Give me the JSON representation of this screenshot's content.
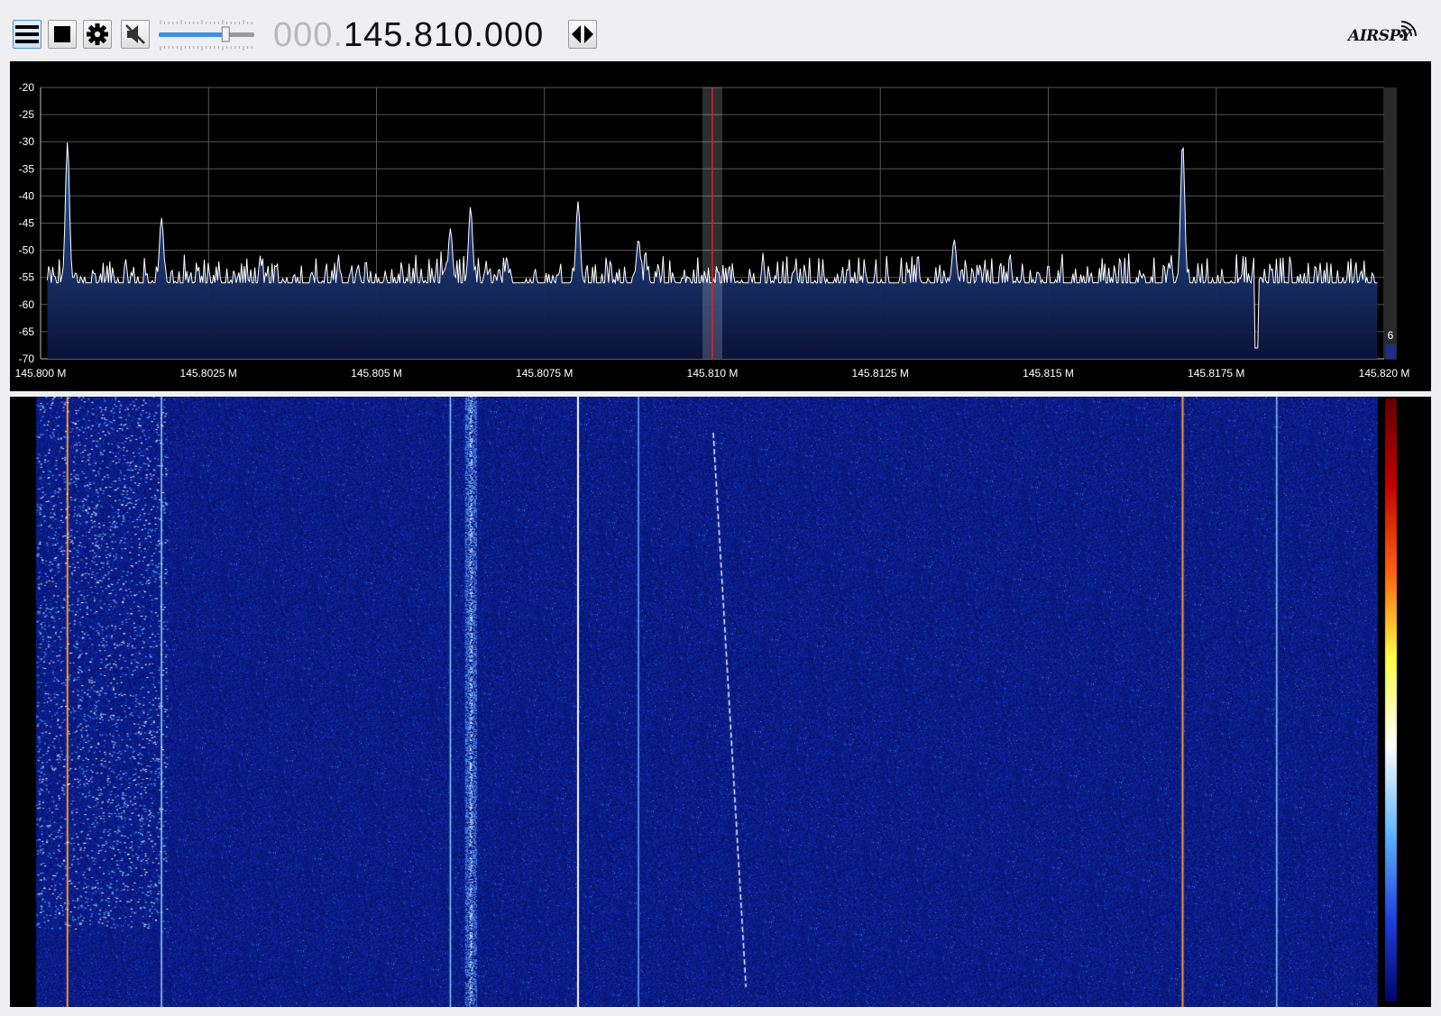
{
  "toolbar": {
    "menu_icon": "hamburger-menu-icon",
    "stop_icon": "stop-square-icon",
    "settings_icon": "gear-icon",
    "mute_icon": "speaker-muted-icon",
    "volume_level": 0.7,
    "frequency_prefix": "000.",
    "frequency_main": "145.810.000",
    "tune_arrows_icon": "left-right-arrows-icon"
  },
  "logo": {
    "text": "AIRSPY",
    "icon": "wireless-signal-icon"
  },
  "spectrum": {
    "y_ticks": [
      "-20",
      "-25",
      "-30",
      "-35",
      "-40",
      "-45",
      "-50",
      "-55",
      "-60",
      "-65",
      "-70"
    ],
    "x_ticks": [
      "145.800 M",
      "145.8025 M",
      "145.805 M",
      "145.8075 M",
      "145.810 M",
      "145.8125 M",
      "145.815 M",
      "145.8175 M",
      "145.820 M"
    ],
    "scroll_value": "6",
    "colors": {
      "trace": "#ffffff",
      "fill": "#1b3a78",
      "grid": "#555555",
      "marker": "#e02020"
    }
  },
  "chart_data": {
    "type": "line",
    "xlabel": "",
    "ylabel": "",
    "xlim": [
      145.8,
      145.82
    ],
    "ylim": [
      -70,
      -20
    ],
    "grid": true,
    "tuned_frequency": 145.81,
    "noise_floor_db": -56,
    "peaks": [
      {
        "x": 145.8004,
        "y": -30
      },
      {
        "x": 145.8018,
        "y": -44
      },
      {
        "x": 145.8061,
        "y": -46
      },
      {
        "x": 145.8064,
        "y": -42
      },
      {
        "x": 145.808,
        "y": -41
      },
      {
        "x": 145.8089,
        "y": -48
      },
      {
        "x": 145.8136,
        "y": -48
      },
      {
        "x": 145.817,
        "y": -30
      },
      {
        "x": 145.8181,
        "y": -68
      }
    ]
  },
  "waterfall": {
    "colormap": [
      "#000060",
      "#1f3fe0",
      "#5fb6ff",
      "#ffffff",
      "#ffff40",
      "#ff6010",
      "#c00000",
      "#600000"
    ]
  }
}
